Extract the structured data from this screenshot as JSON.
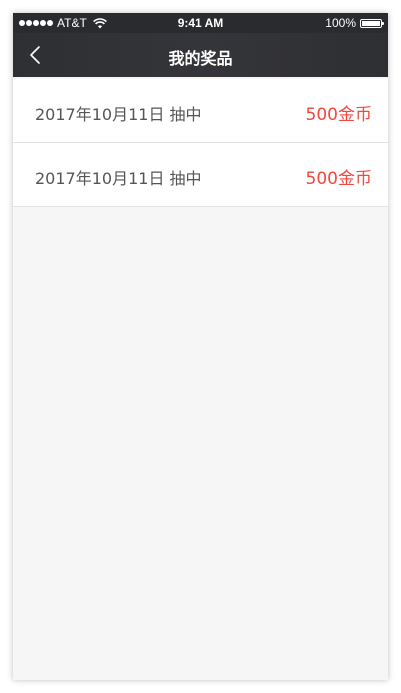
{
  "status_bar": {
    "carrier": "AT&T",
    "time": "9:41 AM",
    "battery": "100%"
  },
  "nav": {
    "title": "我的奖品",
    "back_icon": "chevron-left-icon"
  },
  "prizes": [
    {
      "date": "2017年10月11日 抽中",
      "prize": "500金币"
    },
    {
      "date": "2017年10月11日 抽中",
      "prize": "500金币"
    }
  ],
  "colors": {
    "nav_bg": "#2f3033",
    "accent": "#f2473c",
    "page_bg": "#f5f6f5"
  }
}
